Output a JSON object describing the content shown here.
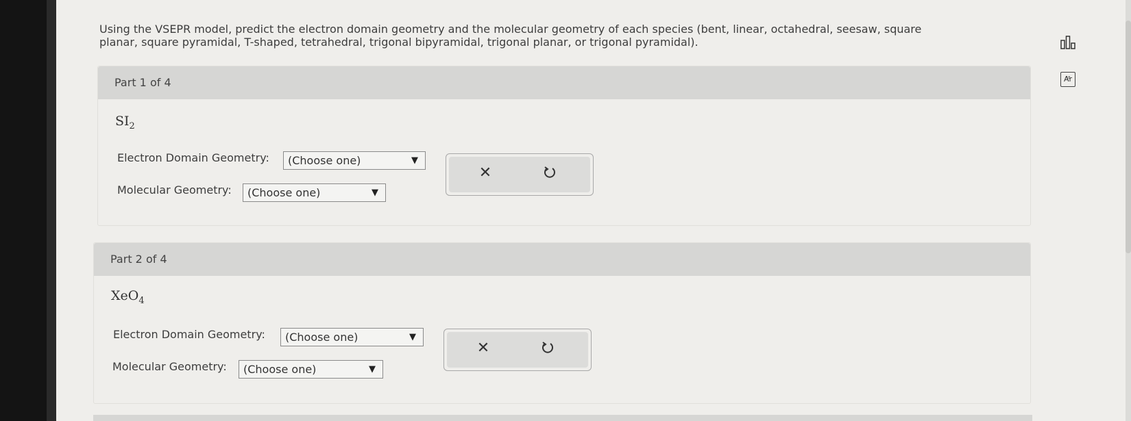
{
  "question": {
    "text": "Using the VSEPR model, predict the electron domain geometry and the molecular geometry of each species (bent, linear, octahedral, seesaw, square planar, square pyramidal, T-shaped, tetrahedral, trigonal bipyramidal, trigonal planar, or trigonal pyramidal)."
  },
  "side_tools": {
    "chart_icon": "bar-chart-icon",
    "periodic_table_icon": "periodic-table-icon",
    "periodic_table_label": "Ar"
  },
  "parts": [
    {
      "header": "Part 1 of 4",
      "formula_main": "SI",
      "formula_sub": "2",
      "electron_label": "Electron Domain Geometry:",
      "electron_value": "(Choose one)",
      "molecular_label": "Molecular Geometry:",
      "molecular_value": "(Choose one)",
      "clear_icon": "close-icon",
      "undo_icon": "undo-icon"
    },
    {
      "header": "Part 2 of 4",
      "formula_main": "XeO",
      "formula_sub": "4",
      "electron_label": "Electron Domain Geometry:",
      "electron_value": "(Choose one)",
      "molecular_label": "Molecular Geometry:",
      "molecular_value": "(Choose one)",
      "clear_icon": "close-icon",
      "undo_icon": "undo-icon"
    }
  ],
  "dropdown_arrow": "▼",
  "clear_glyph": "✕"
}
